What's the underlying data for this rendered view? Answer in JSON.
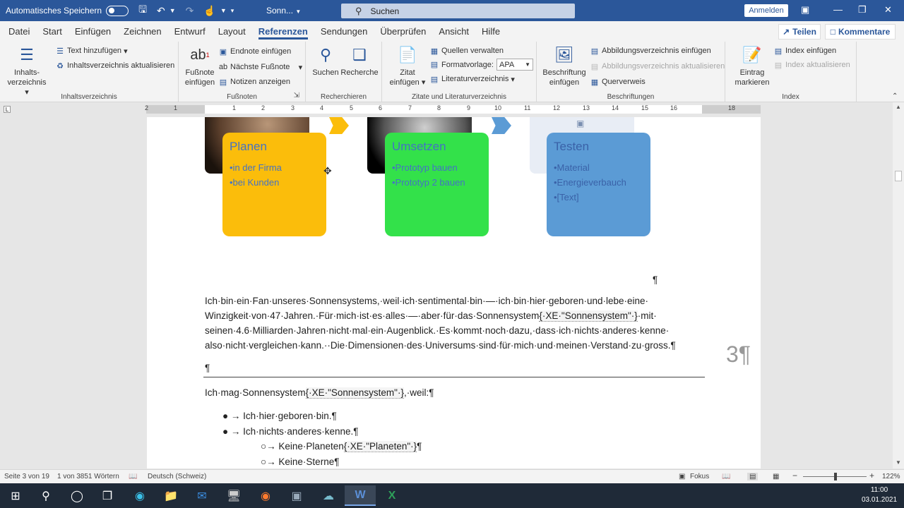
{
  "titlebar": {
    "autosave_label": "Automatisches Speichern",
    "doc_name": "Sonn...",
    "search_placeholder": "Suchen",
    "login_label": "Anmelden"
  },
  "tabs": [
    "Datei",
    "Start",
    "Einfügen",
    "Zeichnen",
    "Entwurf",
    "Layout",
    "Referenzen",
    "Sendungen",
    "Überprüfen",
    "Ansicht",
    "Hilfe"
  ],
  "active_tab": "Referenzen",
  "share_label": "Teilen",
  "comments_label": "Kommentare",
  "ribbon": {
    "toc": {
      "big_label_1": "Inhalts-",
      "big_label_2": "verzeichnis",
      "add_text": "Text hinzufügen",
      "update_toc": "Inhaltsverzeichnis aktualisieren",
      "group_label": "Inhaltsverzeichnis"
    },
    "footnotes": {
      "big_label_1": "Fußnote",
      "big_label_2": "einfügen",
      "endnote": "Endnote einfügen",
      "next_footnote": "Nächste Fußnote",
      "show_notes": "Notizen anzeigen",
      "group_label": "Fußnoten"
    },
    "research": {
      "search_label": "Suchen",
      "researcher_label": "Recherche",
      "group_label": "Recherchieren"
    },
    "citations": {
      "cite_label_1": "Zitat",
      "cite_label_2": "einfügen",
      "manage_sources": "Quellen verwalten",
      "style_label": "Formatvorlage:",
      "style_value": "APA",
      "bibliography": "Literaturverzeichnis",
      "group_label": "Zitate und Literaturverzeichnis"
    },
    "captions": {
      "caption_label_1": "Beschriftung",
      "caption_label_2": "einfügen",
      "insert_tof": "Abbildungsverzeichnis einfügen",
      "update_tof": "Abbildungsverzeichnis aktualisieren",
      "cross_ref": "Querverweis",
      "group_label": "Beschriftungen"
    },
    "index": {
      "mark_label_1": "Eintrag",
      "mark_label_2": "markieren",
      "insert_index": "Index einfügen",
      "update_index": "Index aktualisieren",
      "group_label": "Index"
    }
  },
  "ruler_numbers": [
    "2",
    "1",
    "1",
    "2",
    "3",
    "4",
    "5",
    "6",
    "7",
    "8",
    "9",
    "10",
    "11",
    "12",
    "13",
    "14",
    "15",
    "16",
    "18"
  ],
  "cards": [
    {
      "title": "Planen",
      "items": [
        "•in der Firma",
        "•bei Kunden"
      ],
      "color": "#fbbd0b"
    },
    {
      "title": "Umsetzen",
      "items": [
        "•Prototyp bauen",
        "•Prototyp 2 bauen"
      ],
      "color": "#33e14a"
    },
    {
      "title": "Testen",
      "items": [
        "•Material",
        "•Energieverbauch",
        "•[Text]"
      ],
      "color": "#5b9bd5"
    }
  ],
  "document": {
    "pilcrow": "¶",
    "para1": [
      "Ich·bin·ein·Fan·unseres·Sonnensystems,·weil·ich·sentimental·bin·—·ich·bin·hier·geboren·und·lebe·eine·",
      "Winzigkeit·von·47·Jahren.·Für·mich·ist·es·alles·—·aber·für·das·Sonnensystem",
      "{·XE·\"Sonnensystem\"·}",
      "·mit·",
      "seinen·4.6·Milliarden·Jahren·nicht·mal·ein·Augenblick.·Es·kommt·noch·dazu,·dass·ich·nichts·anderes·kenne·",
      "also·nicht·vergleichen·kann.··Die·Dimensionen·des·Universums·sind·für·mich·und·meinen·Verstand·zu·gross.¶"
    ],
    "page_number": "3¶",
    "line2_a": "Ich·mag·Sonnensystem",
    "line2_field": "{·XE·\"Sonnensystem\"·}",
    "line2_b": ",·weil:¶",
    "bullet1": "→ Ich·hier·geboren·bin.¶",
    "bullet2": "→ Ich·nichts·anderes·kenne.¶",
    "sub1_a": "→ Keine·Planeten",
    "sub1_field": "{·XE·\"Planeten\"·}",
    "sub1_b": "¶",
    "sub2": "→ Keine·Sterne¶"
  },
  "statusbar": {
    "page": "Seite 3 von 19",
    "words": "1 von 3851 Wörtern",
    "language": "Deutsch (Schweiz)",
    "focus": "Fokus",
    "zoom": "122%",
    "zoom_minus": "−",
    "zoom_plus": "+"
  },
  "taskbar": {
    "time": "11:00",
    "date": "03.01.2021"
  }
}
